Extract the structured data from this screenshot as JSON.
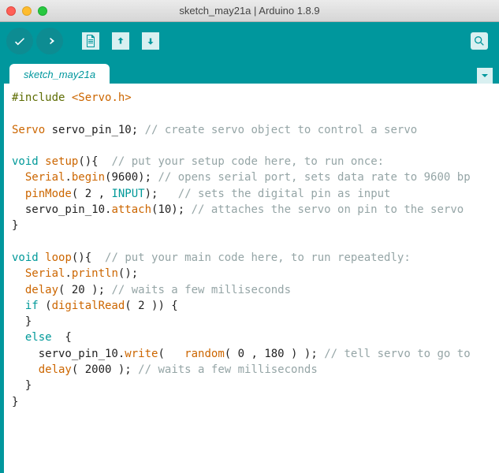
{
  "window": {
    "title": "sketch_may21a | Arduino 1.8.9"
  },
  "tab": {
    "name": "sketch_may21a"
  },
  "code": {
    "l1_include": "#include",
    "l1_lib": "<Servo.h>",
    "l3_type": "Servo",
    "l3_var": " servo_pin_10; ",
    "l3_c": "// create servo object to control a servo",
    "l5_kw": "void",
    "l5_fn": "setup",
    "l5_rest": "(){  ",
    "l5_c": "// put your setup code here, to run once:",
    "l6_s": "  ",
    "l6_obj": "Serial",
    "l6_dot": ".",
    "l6_fn": "begin",
    "l6_args": "(9600); ",
    "l6_c": "// opens serial port, sets data rate to 9600 bp",
    "l7_s": "  ",
    "l7_fn": "pinMode",
    "l7_a1": "( 2 , ",
    "l7_kw": "INPUT",
    "l7_a2": ");   ",
    "l7_c": "// sets the digital pin as input",
    "l8_s": "  servo_pin_10.",
    "l8_fn": "attach",
    "l8_args": "(10); ",
    "l8_c": "// attaches the servo on pin to the servo ",
    "l9": "}",
    "l11_kw": "void",
    "l11_fn": "loop",
    "l11_rest": "(){  ",
    "l11_c": "// put your main code here, to run repeatedly:",
    "l12_s": "  ",
    "l12_obj": "Serial",
    "l12_dot": ".",
    "l12_fn": "println",
    "l12_args": "();",
    "l13_s": "  ",
    "l13_fn": "delay",
    "l13_args": "( 20 ); ",
    "l13_c": "// waits a few milliseconds",
    "l14_s": "  ",
    "l14_kw": "if",
    "l14_a1": " (",
    "l14_fn": "digitalRead",
    "l14_a2": "( 2 )) {",
    "l15": "  }",
    "l16_s": "  ",
    "l16_kw": "else",
    "l16_rest": "  {",
    "l17_s": "    servo_pin_10.",
    "l17_fn": "write",
    "l17_a1": "(   ",
    "l17_fn2": "random",
    "l17_a2": "( 0 , 180 ) ); ",
    "l17_c": "// tell servo to go to",
    "l18_s": "    ",
    "l18_fn": "delay",
    "l18_args": "( 2000 ); ",
    "l18_c": "// waits a few milliseconds",
    "l19": "  }",
    "l20": "}"
  }
}
